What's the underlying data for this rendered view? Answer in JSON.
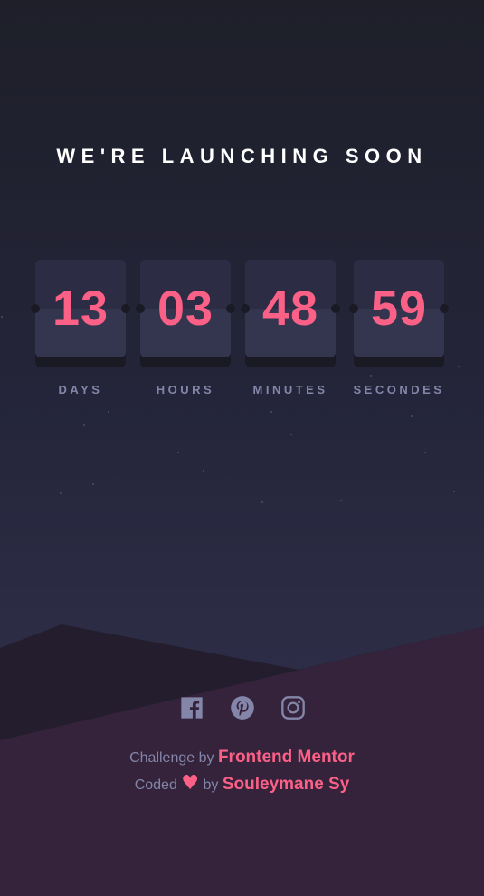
{
  "title": "WE'RE LAUNCHING SOON",
  "countdown": [
    {
      "value": "13",
      "label": "DAYS"
    },
    {
      "value": "03",
      "label": "HOURS"
    },
    {
      "value": "48",
      "label": "MINUTES"
    },
    {
      "value": "59",
      "label": "SECONDES"
    }
  ],
  "social": [
    "facebook-icon",
    "pinterest-icon",
    "instagram-icon"
  ],
  "credits": {
    "challenge_prefix": "Challenge by",
    "challenge_link": "Frontend Mentor",
    "coded_prefix": "Coded",
    "heart": "♥",
    "coded_by": "by",
    "author_link": "Souleymane Sy"
  },
  "colors": {
    "accent": "#fb6087",
    "muted": "#8486a9",
    "card": "#34364f"
  }
}
